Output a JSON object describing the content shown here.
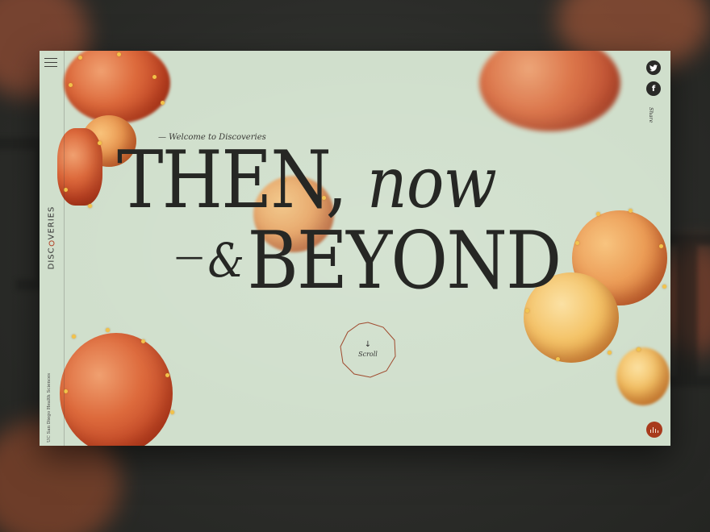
{
  "menu": {
    "icon": "hamburger-menu-icon"
  },
  "brand": {
    "pre": "DISC",
    "post": "VERIES",
    "accent_color": "#b3452a"
  },
  "org": {
    "name": "UC San Diego Health Sciences"
  },
  "hero": {
    "kicker": "— Welcome to Discoveries",
    "line1_word": "THEN,",
    "line1_italic": "now",
    "line2_dash": "—",
    "line2_amp": "&",
    "line2_word": "BEYOND"
  },
  "scroll": {
    "label": "Scroll",
    "icon": "arrow-down-icon"
  },
  "share": {
    "label": "Share",
    "twitter_icon": "twitter-icon",
    "facebook_icon": "facebook-icon"
  },
  "audio": {
    "icon": "audio-bars-icon",
    "color": "#a83a1c"
  },
  "colors": {
    "background": "#d0dfcc",
    "text": "#262724",
    "backdrop": "#2a2b28"
  }
}
